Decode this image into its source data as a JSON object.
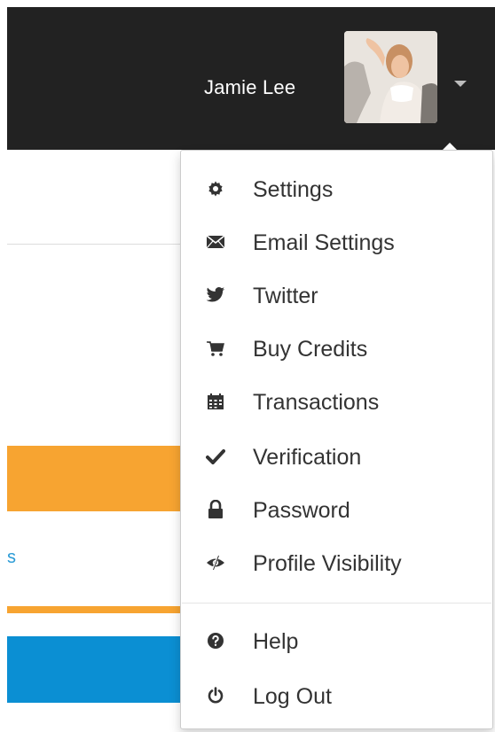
{
  "navbar": {
    "user_name": "Jamie Lee"
  },
  "menu": {
    "items": [
      {
        "label": "Settings",
        "icon": "gear-icon"
      },
      {
        "label": "Email Settings",
        "icon": "envelope-icon"
      },
      {
        "label": "Twitter",
        "icon": "twitter-icon"
      },
      {
        "label": "Buy Credits",
        "icon": "cart-icon"
      },
      {
        "label": "Transactions",
        "icon": "calendar-icon"
      },
      {
        "label": "Verification",
        "icon": "check-icon",
        "highlighted": true
      },
      {
        "label": "Password",
        "icon": "lock-icon"
      },
      {
        "label": "Profile Visibility",
        "icon": "eye-slash-icon"
      },
      {
        "label": "Help",
        "icon": "question-circle-icon"
      },
      {
        "label": "Log Out",
        "icon": "power-icon"
      }
    ]
  },
  "background_page": {
    "link_fragment": "s"
  },
  "colors": {
    "navbar": "#222222",
    "highlight": "#fbfb2c",
    "orange": "#f7a431",
    "blue": "#0b8fd3",
    "icon": "#333333"
  }
}
